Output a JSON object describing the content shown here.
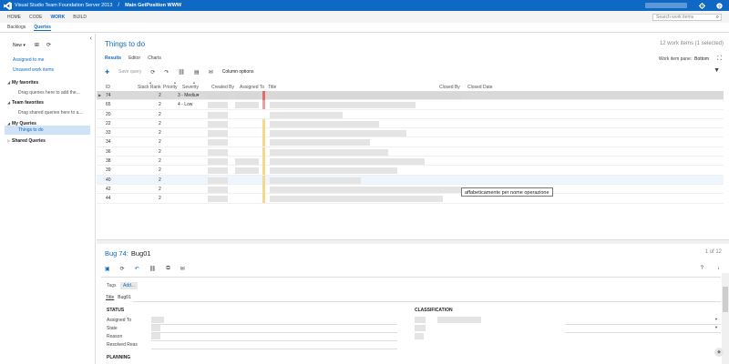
{
  "topbar": {
    "app_title": "Visual Studio Team Foundation Server 2013",
    "separator": "/",
    "project": "Main GetPosition WWW"
  },
  "nav": [
    "HOME",
    "CODE",
    "WORK",
    "BUILD"
  ],
  "nav_active": "WORK",
  "search": {
    "placeholder": "Search work items"
  },
  "subnav": [
    "Backlogs",
    "Queries"
  ],
  "subnav_active": "Queries",
  "left": {
    "new_label": "New",
    "assigned_to_me": "Assigned to me",
    "unsaved": "Unsaved work items",
    "my_favorites": "My favorites",
    "my_favorites_hint": "Drag queries here to add the...",
    "team_favorites": "Team favorites",
    "team_favorites_hint": "Drag shared queries here to a...",
    "my_queries": "My Queries",
    "selected_query": "Things to do",
    "shared_queries": "Shared Queries"
  },
  "main": {
    "title": "Things to do",
    "count": "12 work items (1 selected)",
    "tabs": [
      "Results",
      "Editor",
      "Charts"
    ],
    "tab_active": "Results",
    "pane_label": "Work item pane:",
    "pane_value": "Bottom",
    "save_query": "Save query",
    "column_options": "Column options"
  },
  "columns": [
    "ID",
    "Stack Rank",
    "Priority",
    "Severity",
    "Created By",
    "Assigned To",
    "Title",
    "Closed By",
    "Closed Date"
  ],
  "rows": [
    {
      "id": "74",
      "priority": "2",
      "severity": "3 - Mediu▾",
      "stripe": "#e06b6b"
    },
    {
      "id": "65",
      "priority": "2",
      "severity": "4 - Low",
      "stripe": "#e8a0a0"
    },
    {
      "id": "20",
      "priority": "2",
      "severity": "",
      "stripe": ""
    },
    {
      "id": "22",
      "priority": "2",
      "severity": "",
      "stripe": "#f3d98a"
    },
    {
      "id": "33",
      "priority": "2",
      "severity": "",
      "stripe": "#f3d98a"
    },
    {
      "id": "34",
      "priority": "2",
      "severity": "",
      "stripe": "#f3d98a"
    },
    {
      "id": "36",
      "priority": "2",
      "severity": "",
      "stripe": "#f3d98a"
    },
    {
      "id": "38",
      "priority": "2",
      "severity": "",
      "stripe": "#f3d98a"
    },
    {
      "id": "39",
      "priority": "2",
      "severity": "",
      "stripe": "#f3d98a"
    },
    {
      "id": "40",
      "priority": "2",
      "severity": "",
      "stripe": "#f3d98a"
    },
    {
      "id": "42",
      "priority": "2",
      "severity": "",
      "stripe": "#f3d98a"
    },
    {
      "id": "44",
      "priority": "2",
      "severity": "",
      "stripe": "#f3d98a"
    }
  ],
  "tooltip": "affabeticamente per nome operazione",
  "bug": {
    "type_id": "Bug 74:",
    "title": "Bug01",
    "of": "1 of 12",
    "tags_label": "Tags",
    "add_label": "Add...",
    "title_label": "Title",
    "title_value": "Bug01",
    "status": "STATUS",
    "classification": "CLASSIFICATION",
    "assigned_to": "Assigned To",
    "state": "State",
    "reason": "Reason",
    "resolved_reason": "Resolved Reas",
    "planning": "PLANNING"
  },
  "colors": {
    "accent": "#0f69c4",
    "topbar": "#0f69c4",
    "selection": "#cfe2f6"
  }
}
